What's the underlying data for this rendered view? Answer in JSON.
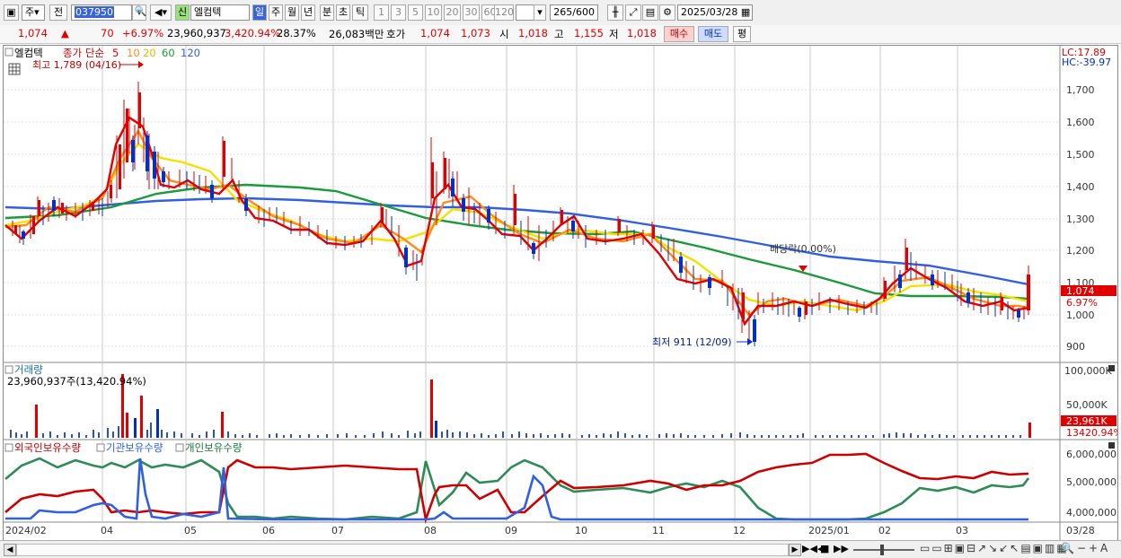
{
  "toolbar": {
    "market_select": "주",
    "prev_label": "전",
    "code": "037950",
    "badge": "신",
    "stock_name": "엘컴텍",
    "periods": [
      "일",
      "주",
      "월",
      "년",
      "분",
      "초",
      "틱"
    ],
    "intervals": [
      "1",
      "3",
      "5",
      "10",
      "20",
      "30",
      "60",
      "120"
    ],
    "count": "265",
    "count_max": "/600",
    "date": "2025/03/28"
  },
  "quote": {
    "price": "1,074",
    "change_arrow": "▲",
    "change": "70",
    "change_rate": "+6.97%",
    "volume": "23,960,937",
    "volume_rate": "3,420.94%",
    "turnover": "28.37%",
    "amount": "26,083백만",
    "ask_label": "호가",
    "ask1": "1,074",
    "ask2": "1,073",
    "open_label": "시",
    "open": "1,018",
    "high_label": "고",
    "high": "1,155",
    "low_label": "저",
    "low": "1,018",
    "buy_label": "매수",
    "sell_label": "매도",
    "eval_label": "평"
  },
  "colors": {
    "up": "#e00000",
    "down": "#0030c8",
    "ma5": "#e00000",
    "ma10": "#ff8c1a",
    "ma20": "#f5e000",
    "ma60": "#1a9a3a",
    "ma120": "#3060e0"
  },
  "price_panel": {
    "title": "엘컴텍",
    "legend_prefix": "종가 단순",
    "ma_labels": [
      "5",
      "10",
      "20",
      "60",
      "120"
    ],
    "high_marker": "최고 1,789 (04/16)",
    "low_marker": "최저 911 (12/09)",
    "dividend_marker": "배당락(0.00%)",
    "lc": "LC:17.89",
    "hc": "HC:-39.97",
    "y_ticks": [
      "1,700",
      "1,600",
      "1,500",
      "1,400",
      "1,300",
      "1,200",
      "1,100",
      "1,000",
      "900"
    ],
    "price_tag": "1,074",
    "rate_tag": "6.97%"
  },
  "volume_panel": {
    "title": "거래량",
    "value_text": "23,960,937주(13,420.94%)",
    "y_ticks": [
      "100,000K",
      "50,000K"
    ],
    "tag": "23,961K",
    "rate_tag": "13420.94%"
  },
  "holding_panel": {
    "labels": [
      "외국인보유수량",
      "기관보유수량",
      "개인보유수량"
    ],
    "y_ticks": [
      "6,000,000",
      "5,000,000",
      "4,000,000"
    ]
  },
  "x_axis": {
    "labels": [
      "2024/02",
      "04",
      "05",
      "06",
      "07",
      "08",
      "09",
      "10",
      "11",
      "12",
      "2025/01",
      "02",
      "03"
    ],
    "end_label": "03/28"
  }
}
